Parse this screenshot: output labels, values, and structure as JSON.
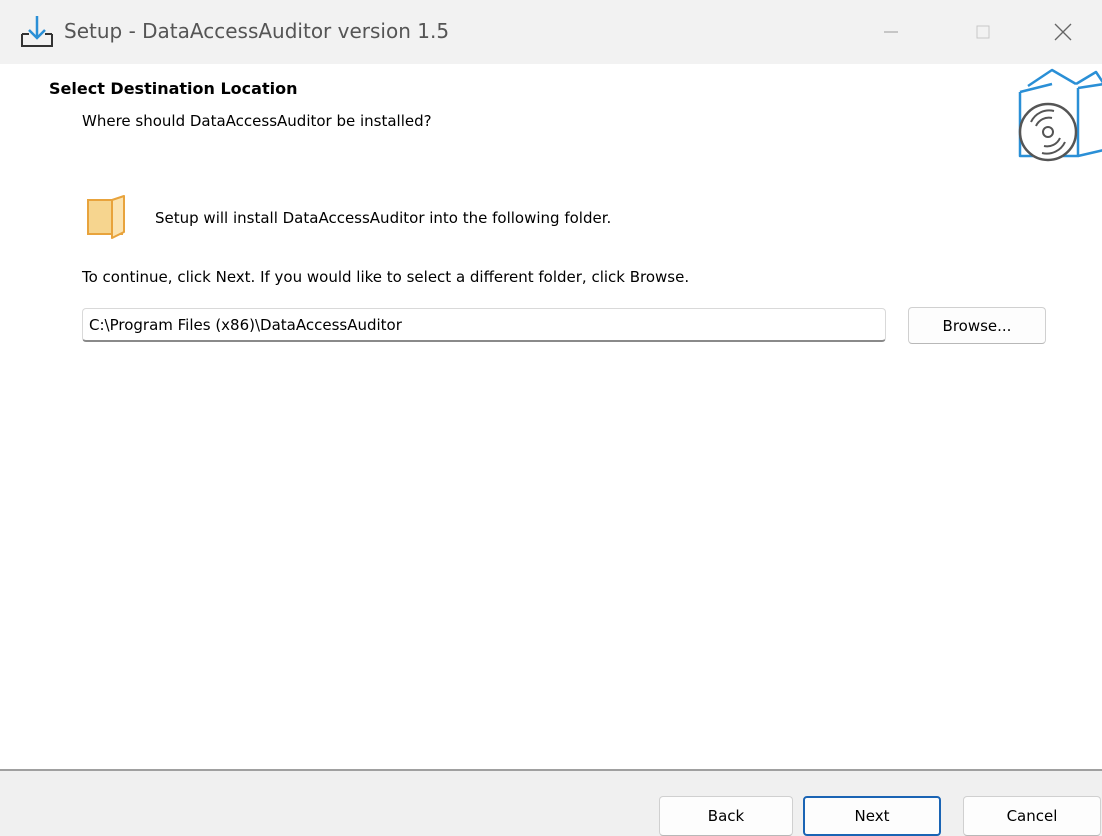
{
  "window": {
    "title": "Setup - DataAccessAuditor version 1.5",
    "controls": {
      "minimize_icon": "minimize-icon",
      "maximize_icon": "maximize-icon",
      "close_icon": "close-icon"
    }
  },
  "header": {
    "title": "Select Destination Location",
    "subtitle": "Where should DataAccessAuditor be installed?"
  },
  "body": {
    "install_info": "Setup will install DataAccessAuditor into the following folder.",
    "continue_info": "To continue, click Next. If you would like to select a different folder, click Browse.",
    "path_value": "C:\\Program Files (x86)\\DataAccessAuditor",
    "browse_label": "Browse..."
  },
  "footer": {
    "back_label": "Back",
    "next_label": "Next",
    "cancel_label": "Cancel"
  },
  "colors": {
    "accent": "#1a64b4",
    "icon_blue": "#2a8fd6",
    "folder_fill": "#f6d58f",
    "folder_stroke": "#e8a33c",
    "footer_bg": "#f0f0f0"
  }
}
